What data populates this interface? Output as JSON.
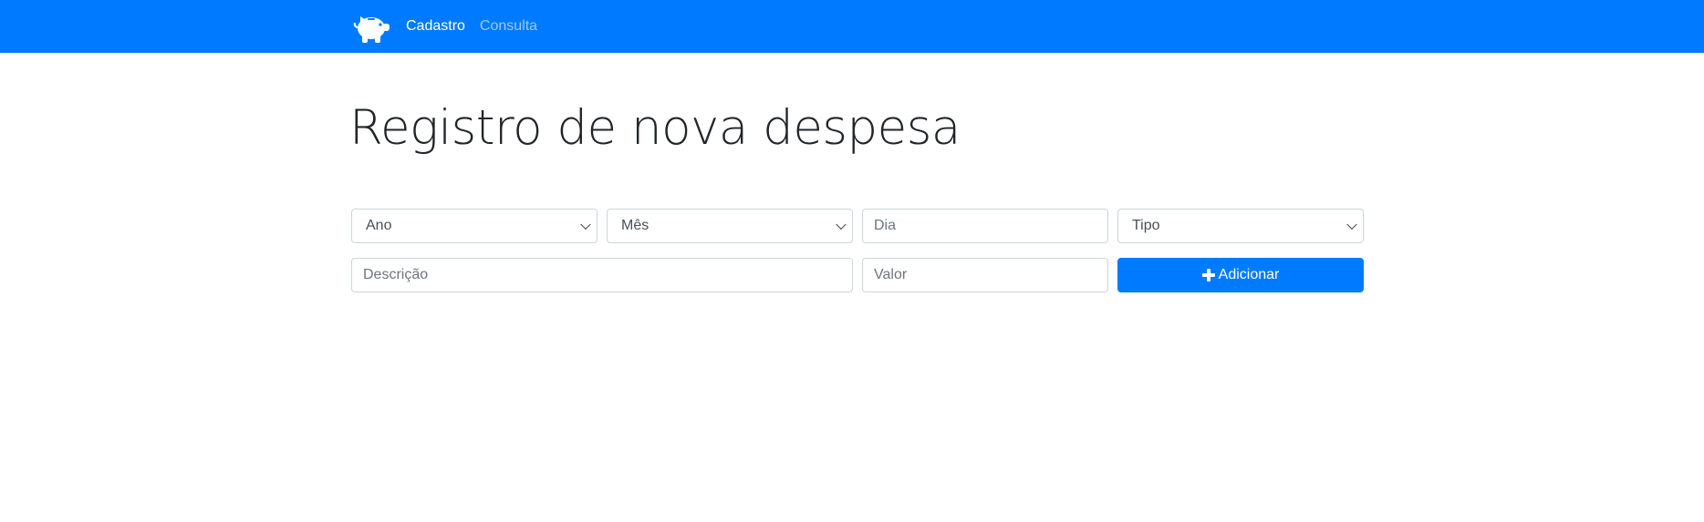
{
  "colors": {
    "primary": "#007bff",
    "text_dark": "#212529",
    "border": "#ced4da",
    "placeholder": "#6c757d"
  },
  "navbar": {
    "logo_icon": "piggy-bank-icon",
    "links": [
      {
        "label": "Cadastro",
        "active": true
      },
      {
        "label": "Consulta",
        "active": false
      }
    ]
  },
  "page": {
    "title": "Registro de nova despesa"
  },
  "form": {
    "ano": {
      "selected": "Ano"
    },
    "mes": {
      "selected": "Mês"
    },
    "dia": {
      "placeholder": "Dia",
      "value": ""
    },
    "tipo": {
      "selected": "Tipo"
    },
    "descricao": {
      "placeholder": "Descrição",
      "value": ""
    },
    "valor": {
      "placeholder": "Valor",
      "value": ""
    },
    "submit": {
      "label": "Adicionar",
      "icon": "plus-icon"
    }
  }
}
